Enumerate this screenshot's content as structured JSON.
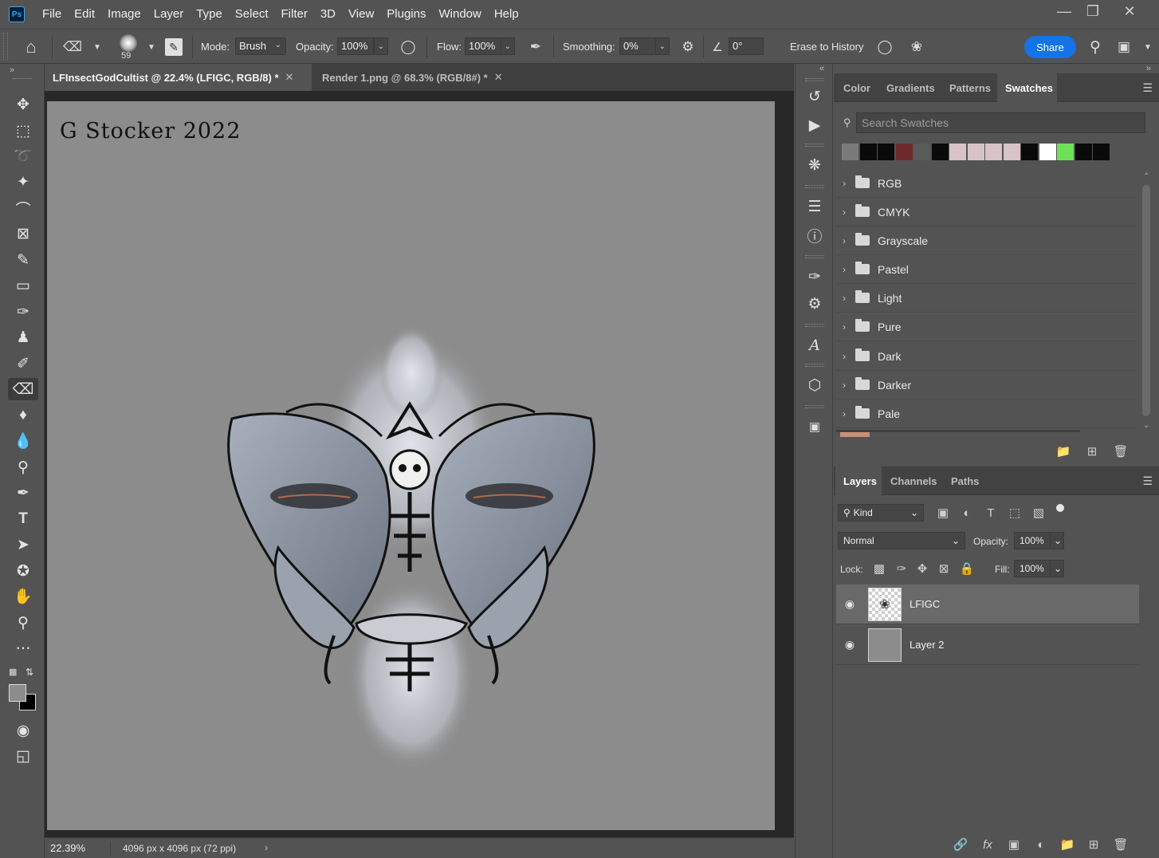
{
  "menu": {
    "logo": "Ps",
    "items": [
      "File",
      "Edit",
      "Image",
      "Layer",
      "Type",
      "Select",
      "Filter",
      "3D",
      "View",
      "Plugins",
      "Window",
      "Help"
    ]
  },
  "options": {
    "brush_size": "59",
    "mode_label": "Mode:",
    "mode_value": "Brush",
    "opacity_label": "Opacity:",
    "opacity_value": "100%",
    "flow_label": "Flow:",
    "flow_value": "100%",
    "smoothing_label": "Smoothing:",
    "smoothing_value": "0%",
    "angle_value": "0°",
    "erase_history_label": "Erase to History",
    "share_label": "Share"
  },
  "documents": {
    "tabs": [
      {
        "label": "LFInsectGodCultist @ 22.4% (LFIGC, RGB/8) *",
        "active": true
      },
      {
        "label": "Render 1.png @ 68.3% (RGB/8#) *",
        "active": false
      }
    ],
    "canvas_signature": "G Stocker 2022"
  },
  "status": {
    "zoom": "22.39%",
    "doc_info": "4096 px x 4096 px (72 ppi)"
  },
  "swatches_panel": {
    "tabs": [
      "Color",
      "Gradients",
      "Patterns",
      "Swatches"
    ],
    "active_tab": "Swatches",
    "search_placeholder": "Search Swatches",
    "recent_colors": [
      "#7a7a7a",
      "#0a0a0a",
      "#0a0a0a",
      "#6e2a2a",
      "#5a5a5a",
      "#0a0a0a",
      "#d8c4c8",
      "#d8c4c8",
      "#d8c4c8",
      "#d8c4c8",
      "#0a0a0a",
      "#ffffff",
      "#6ee05a",
      "#0a0a0a",
      "#0a0a0a"
    ],
    "groups": [
      "RGB",
      "CMYK",
      "Grayscale",
      "Pastel",
      "Light",
      "Pure",
      "Dark",
      "Darker",
      "Pale"
    ]
  },
  "layers_panel": {
    "tabs": [
      "Layers",
      "Channels",
      "Paths"
    ],
    "active_tab": "Layers",
    "filter_label": "Kind",
    "blend_mode": "Normal",
    "opacity_label": "Opacity:",
    "opacity_value": "100%",
    "lock_label": "Lock:",
    "fill_label": "Fill:",
    "fill_value": "100%",
    "layers": [
      {
        "name": "LFIGC",
        "selected": true,
        "visible": true
      },
      {
        "name": "Layer 2",
        "selected": false,
        "visible": true
      }
    ]
  },
  "colors": {
    "accent": "#1473e6",
    "canvas_gray": "#8c8c8c",
    "panel_bg": "#535353"
  }
}
